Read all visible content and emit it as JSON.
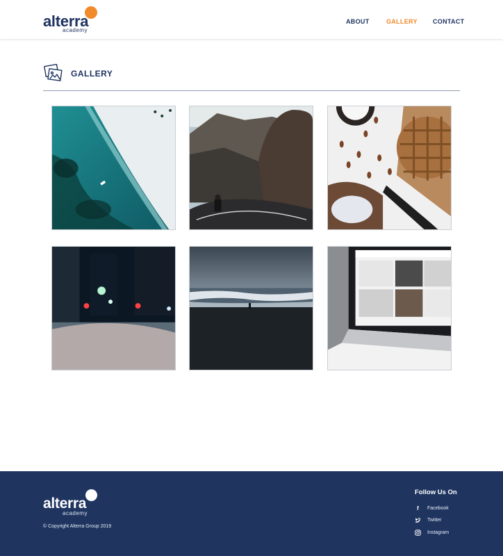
{
  "brand": {
    "name": "alterra",
    "sub": "academy",
    "dot_color": "#f08a2b"
  },
  "nav": {
    "items": [
      {
        "label": "ABOUT",
        "active": false
      },
      {
        "label": "GALLERY",
        "active": true
      },
      {
        "label": "CONTACT",
        "active": false
      }
    ],
    "active_color": "#f08a2b"
  },
  "gallery": {
    "title": "GALLERY",
    "icon": "photos-icon",
    "images": [
      {
        "name": "aerial-beach-photo"
      },
      {
        "name": "mountain-motorcycle-road-photo"
      },
      {
        "name": "pie-and-almonds-photo"
      },
      {
        "name": "city-night-street-photo"
      },
      {
        "name": "stormy-sea-shore-photo"
      },
      {
        "name": "laptop-on-desk-photo"
      }
    ]
  },
  "footer": {
    "brand": {
      "name": "alterra",
      "sub": "academy"
    },
    "copyright": "© Copyright Alterra Group 2019",
    "follow_title": "Follow Us On",
    "social": [
      {
        "label": "Facebook",
        "icon": "facebook-icon"
      },
      {
        "label": "Twitter",
        "icon": "twitter-icon"
      },
      {
        "label": "Instagram",
        "icon": "instagram-icon"
      }
    ],
    "background": "#1f3560"
  }
}
